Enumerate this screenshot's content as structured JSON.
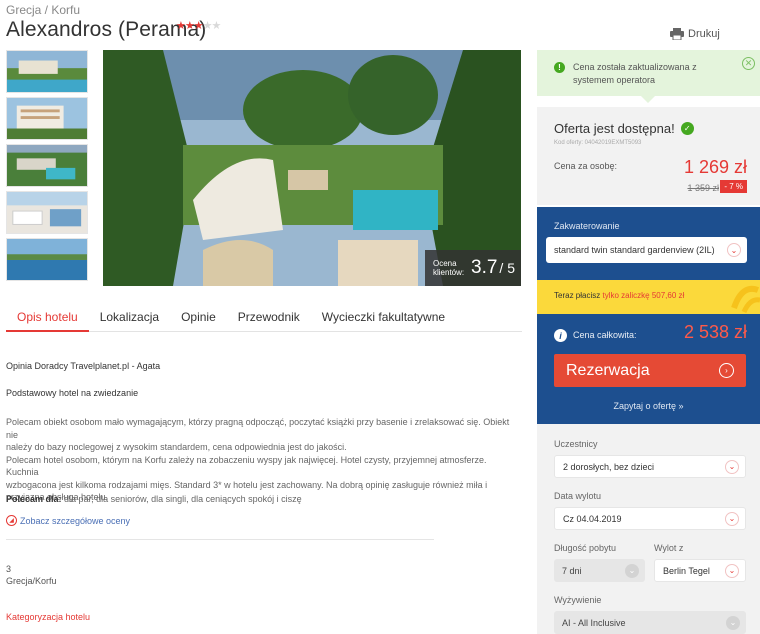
{
  "breadcrumb": "Grecja / Korfu",
  "hotel": {
    "name": "Alexandros (Perama)",
    "stars": 3,
    "stars_max": 5
  },
  "print_label": "Drukuj",
  "rating": {
    "label_line1": "Ocena",
    "label_line2": "klientów:",
    "score": "3.7",
    "max": "/ 5"
  },
  "tabs": [
    {
      "label": "Opis hotelu",
      "active": true
    },
    {
      "label": "Lokalizacja",
      "active": false
    },
    {
      "label": "Opinie",
      "active": false
    },
    {
      "label": "Przewodnik",
      "active": false
    },
    {
      "label": "Wycieczki fakultatywne",
      "active": false
    }
  ],
  "description": {
    "advisor": "Opinia Doradcy Travelplanet.pl - Agata",
    "subheading": "Podstawowy hotel na zwiedzanie",
    "text_lines": [
      "Polecam obiekt osobom mało wymagającym, którzy pragną odpocząć, poczytać książki przy basenie i zrelaksować się. Obiekt nie",
      "należy do bazy noclegowej z wysokim standardem, cena odpowiednia jest do jakości.",
      "Polecam hotel osobom, którym na Korfu zależy na zobaczeniu wyspy jak najwięcej. Hotel czysty, przyjemnej atmosferze. Kuchnia",
      "wzbogacona jest kilkoma rodzajami mięs. Standard 3* w hotelu jest zachowany. Na dobrą opinię zasługuje również miła i",
      "przyjazna obsługa hotelu."
    ],
    "recommend_label": "Polecam dla:",
    "recommend_text": "dla par, dla seniorów, dla singli, dla ceniących spokój i ciszę",
    "details_link": "Zobacz szczegółowe oceny",
    "number": "3",
    "region": "Grecja/Korfu",
    "category_link": "Kategoryzacja hotelu"
  },
  "sidebar": {
    "notice": "Cena została zaktualizowana z systemem operatora",
    "offer": {
      "title": "Oferta jest dostępna!",
      "code": "Kod oferty: 04042019EXMT5093",
      "per_person_label": "Cena za osobę:",
      "price": "1 269 zł",
      "old_price": "1 359 zł",
      "discount": "- 7 %"
    },
    "accommodation": {
      "label": "Zakwaterowanie",
      "value": "standard twin standard gardenview (2IL)"
    },
    "deposit": {
      "prefix": "Teraz płacisz ",
      "highlight": "tylko zaliczkę 507,60 zł"
    },
    "total": {
      "label": "Cena całkowita:",
      "value": "2 538 zł",
      "book_label": "Rezerwacja",
      "ask_label": "Zapytaj o ofertę »"
    },
    "participants": {
      "label": "Uczestnicy",
      "value": "2 dorosłych, bez dzieci"
    },
    "departure_date": {
      "label": "Data wylotu",
      "value": "Cz 04.04.2019"
    },
    "duration": {
      "label": "Długość pobytu",
      "value": "7 dni"
    },
    "departure_from": {
      "label": "Wylot z",
      "value": "Berlin Tegel"
    },
    "board": {
      "label": "Wyżywienie",
      "value": "AI - All Inclusive"
    }
  },
  "colors": {
    "accent": "#e53935",
    "navy": "#1d4f8f",
    "yellow": "#fbd93b",
    "green": "#45a820"
  }
}
